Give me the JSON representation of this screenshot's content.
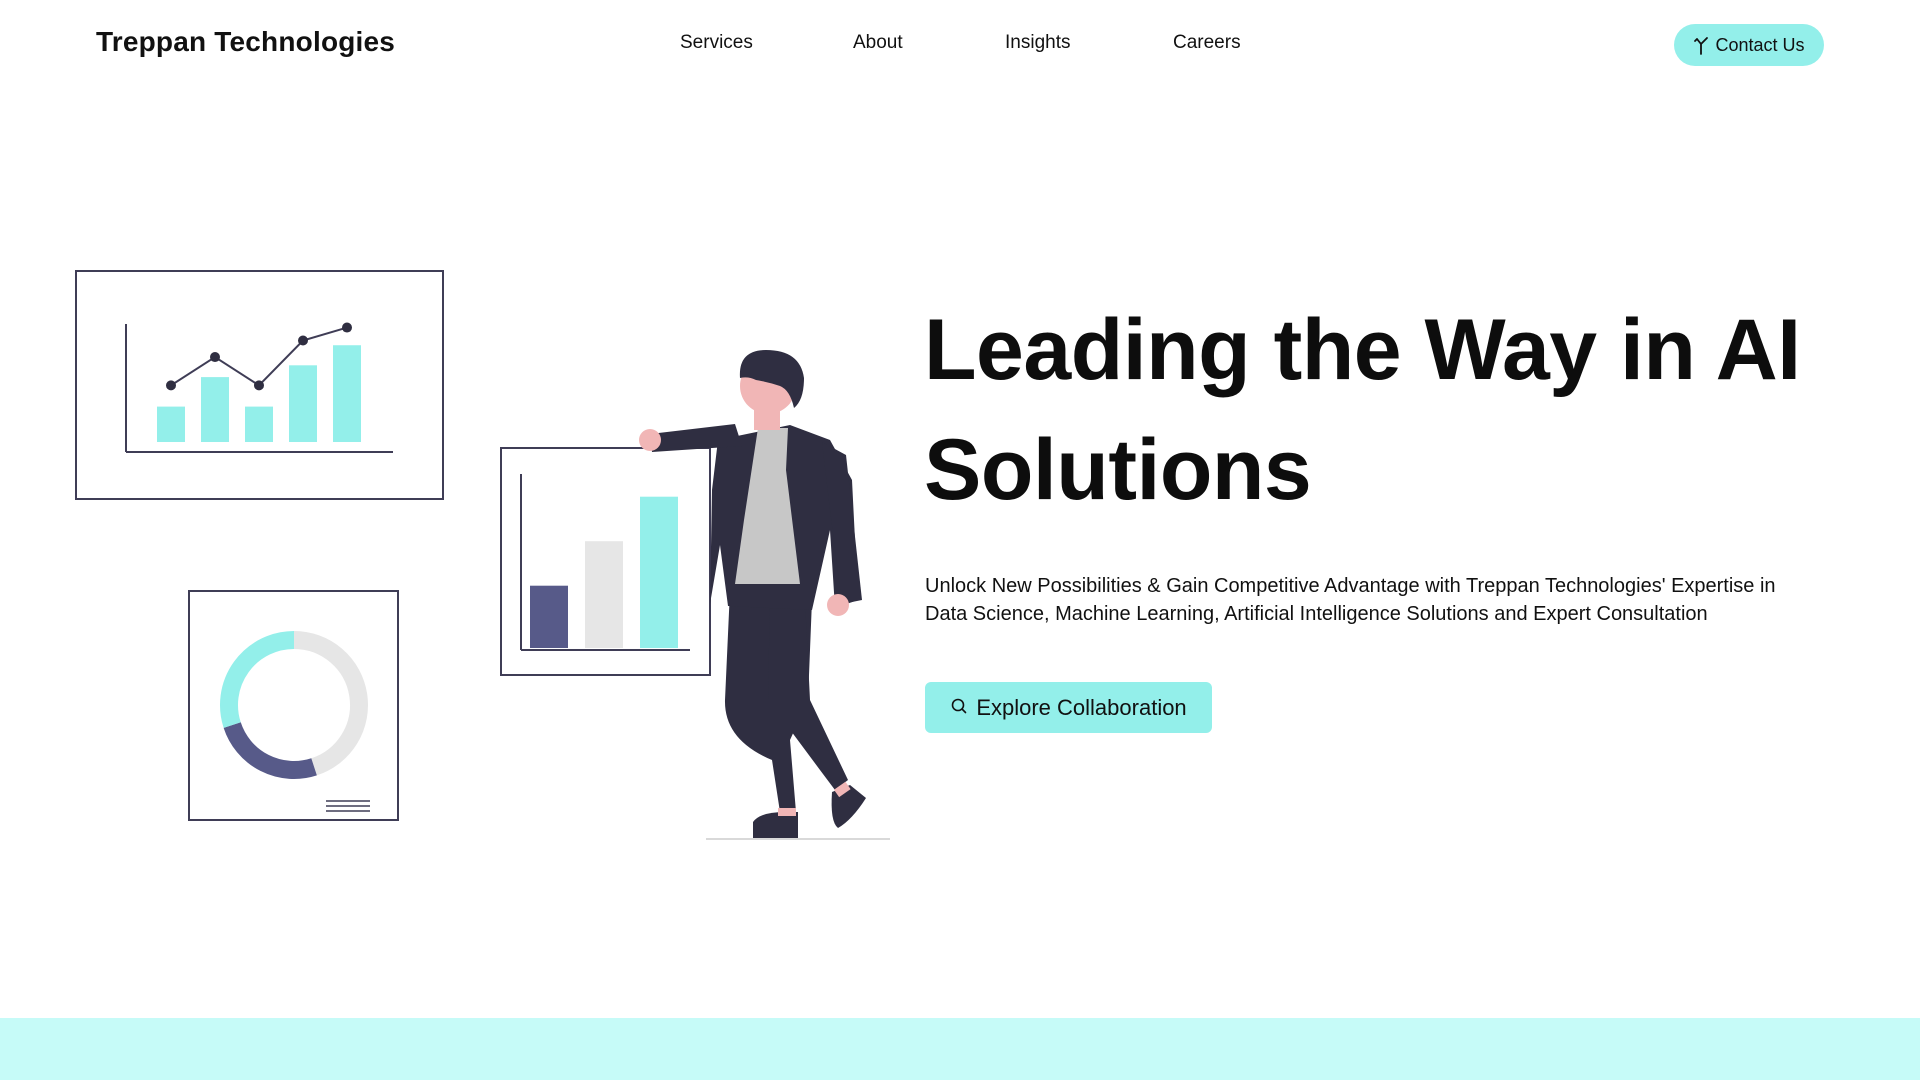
{
  "header": {
    "logo": "Treppan Technologies",
    "nav": [
      {
        "label": "Services"
      },
      {
        "label": "About"
      },
      {
        "label": "Insights"
      },
      {
        "label": "Careers"
      }
    ],
    "contact_label": "Contact Us",
    "contact_icon": "hand-pointer-icon"
  },
  "hero": {
    "title_line1": "Leading the Way in AI",
    "title_line2": "Solutions",
    "subtitle_line1": "Unlock New Possibilities & Gain Competitive Advantage with Treppan Technologies' Expertise in",
    "subtitle_line2": "Data Science, Machine Learning, Artificial Intelligence Solutions and Expert Consultation",
    "cta_label": "Explore Collaboration",
    "cta_icon": "search-icon"
  },
  "illustration": {
    "icon": "businessman-presenting-charts-illustration",
    "line_chart_bars": [
      0.3,
      0.55,
      0.3,
      0.65,
      0.82
    ],
    "line_chart_points": [
      0.48,
      0.72,
      0.48,
      0.86,
      0.97
    ],
    "bar_chart_values": [
      0.35,
      0.6,
      0.85
    ],
    "donut_segments": [
      0.45,
      0.25,
      0.3
    ]
  },
  "colors": {
    "accent": "#93efea",
    "band": "#c6fbf8",
    "dark": "#2f2e41",
    "muted_purple": "#575a89",
    "light_gray": "#e6e6e6",
    "skin": "#f1b6b6"
  }
}
